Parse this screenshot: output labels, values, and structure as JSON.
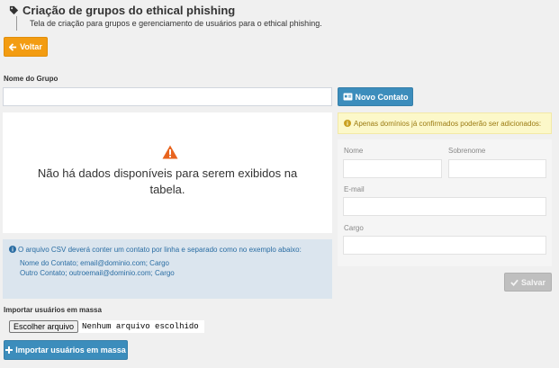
{
  "header": {
    "title": "Criação de grupos do ethical phishing",
    "subtitle": "Tela de criação para grupos e gerenciamento de usuários para o ethical phishing."
  },
  "buttons": {
    "voltar": "Voltar",
    "novo_contato": "Novo Contato",
    "salvar": "Salvar",
    "importar": "Importar usuários em massa"
  },
  "group": {
    "label": "Nome do Grupo",
    "value": ""
  },
  "table": {
    "empty_message": "Não há dados disponíveis para serem exibidos na tabela."
  },
  "csv_info": {
    "text": "O arquivo CSV deverá conter um contato por linha e separado como no exemplo abaixo:",
    "example_lines": [
      "Nome do Contato; email@dominio.com; Cargo",
      "Outro Contato; outroemail@dominio.com; Cargo"
    ]
  },
  "import": {
    "label": "Importar usuários em massa",
    "choose_button": "Escolher arquivo",
    "status": "Nenhum arquivo escolhido"
  },
  "contact_form": {
    "warning": "Apenas domínios já confirmados poderão ser adicionados:",
    "fields": {
      "nome": "Nome",
      "sobrenome": "Sobrenome",
      "email": "E-mail",
      "cargo": "Cargo"
    }
  },
  "colors": {
    "voltar": "#f39c12",
    "primary": "#3c8dbc",
    "disabled": "#bfbfbf",
    "warning_bg": "#fcf8c9",
    "info_bg": "#dbe5ee",
    "warning_icon": "#e8641e"
  },
  "icons": [
    "tag-icon",
    "arrow-left-icon",
    "id-card-icon",
    "warning-triangle-icon",
    "info-circle-icon",
    "plus-icon",
    "check-icon"
  ]
}
